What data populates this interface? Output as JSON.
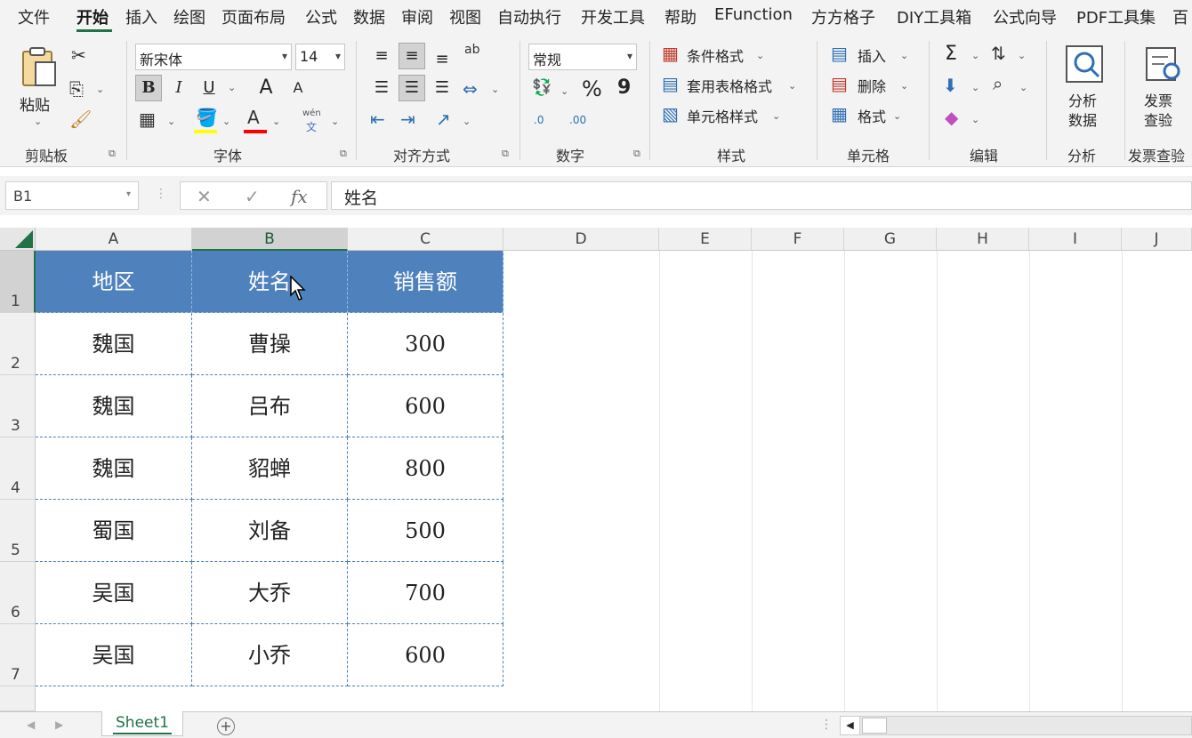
{
  "menu": {
    "tabs": [
      "文件",
      "开始",
      "插入",
      "绘图",
      "页面布局",
      "公式",
      "数据",
      "审阅",
      "视图",
      "自动执行",
      "开发工具",
      "帮助",
      "EFunction",
      "方方格子",
      "DIY工具箱",
      "公式向导",
      "PDF工具集",
      "百"
    ],
    "active": "开始"
  },
  "ribbon": {
    "clipboard": {
      "paste": "粘贴",
      "label": "剪贴板"
    },
    "font": {
      "name": "新宋体",
      "size": "14",
      "bold": "B",
      "italic": "I",
      "underline": "U",
      "grow": "A",
      "shrink": "A",
      "font_color": "A",
      "phonetic_top": "wén",
      "phonetic_bottom": "文",
      "label": "字体"
    },
    "alignment": {
      "label": "对齐方式",
      "wrap": "ab"
    },
    "number": {
      "format": "常规",
      "percent": "%",
      "comma": "9",
      "inc_decimal": ".0",
      "dec_decimal": ".00",
      "label": "数字"
    },
    "styles": {
      "conditional": "条件格式",
      "table": "套用表格格式",
      "cell": "单元格样式",
      "label": "样式"
    },
    "cells": {
      "insert": "插入",
      "delete": "删除",
      "format": "格式",
      "label": "单元格"
    },
    "editing": {
      "sum": "Σ",
      "label": "编辑"
    },
    "analysis": {
      "analyze_line1": "分析",
      "analyze_line2": "数据",
      "label": "分析"
    },
    "invoice": {
      "check_line1": "发票",
      "check_line2": "查验",
      "label": "发票查验"
    }
  },
  "formula_bar": {
    "name_box": "B1",
    "fx": "fx",
    "cancel": "✕",
    "enter": "✓",
    "content": "姓名"
  },
  "columns": [
    "A",
    "B",
    "C",
    "D",
    "E",
    "F",
    "G",
    "H",
    "I",
    "J"
  ],
  "rows": [
    "1",
    "2",
    "3",
    "4",
    "5",
    "6",
    "7"
  ],
  "table": {
    "headers": [
      "地区",
      "姓名",
      "销售额"
    ],
    "rows": [
      [
        "魏国",
        "曹操",
        "300"
      ],
      [
        "魏国",
        "吕布",
        "600"
      ],
      [
        "魏国",
        "貂蝉",
        "800"
      ],
      [
        "蜀国",
        "刘备",
        "500"
      ],
      [
        "吴国",
        "大乔",
        "700"
      ],
      [
        "吴国",
        "小乔",
        "600"
      ]
    ]
  },
  "sheets": {
    "active": "Sheet1",
    "add": "+"
  },
  "colors": {
    "accent": "#217346",
    "header_fill": "#4f81bd",
    "border": "#4d7fb8"
  }
}
